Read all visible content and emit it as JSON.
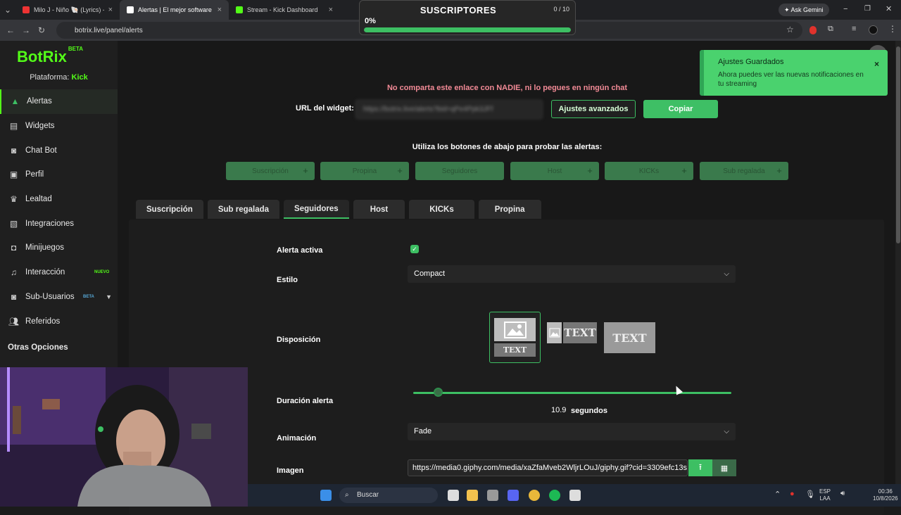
{
  "browser": {
    "tabs": [
      {
        "title": "Milo J - Niño 🐚 (Lyrics) - Y"
      },
      {
        "title": "Alertas | El mejor software para"
      },
      {
        "title": "Stream - Kick Dashboard"
      }
    ],
    "url": "botrix.live/panel/alerts",
    "ask_gemini": "Ask Gemini"
  },
  "subs_widget": {
    "title": "SUSCRIPTORES",
    "count": "0 / 10",
    "percent_label": "0%",
    "progress": 0.0
  },
  "sidebar": {
    "logo": "BotRix",
    "logo_badge": "BETA",
    "platform_label": "Plataforma:",
    "platform_value": "Kick",
    "items": [
      {
        "label": "Alertas",
        "icon": "warning-icon"
      },
      {
        "label": "Widgets",
        "icon": "widgets-icon"
      },
      {
        "label": "Chat Bot",
        "icon": "robot-icon"
      },
      {
        "label": "Perfil",
        "icon": "profile-card-icon"
      },
      {
        "label": "Lealtad",
        "icon": "trophy-icon"
      },
      {
        "label": "Integraciones",
        "icon": "integrations-icon"
      },
      {
        "label": "Minijuegos",
        "icon": "gamepad-icon"
      },
      {
        "label": "Interacción",
        "icon": "music-note-icon",
        "badge": "NUEVO"
      },
      {
        "label": "Sub-Usuarios",
        "icon": "robot-icon",
        "badge": "BETA"
      },
      {
        "label": "Referidos",
        "icon": "users-icon"
      }
    ],
    "other_options": "Otras Opciones"
  },
  "main": {
    "warning": "No comparta este enlace con NADIE, ni lo pegues en ningún chat",
    "url_label": "URL del widget:",
    "url_value": "https://botrix.live/alerts?bid=qPe4Ppk3JFf",
    "advanced_button": "Ajustes avanzados",
    "copy_button": "Copiar",
    "test_title": "Utiliza los botones de abajo para probar las alertas:",
    "test_buttons": [
      "Suscripción",
      "Propina",
      "Seguidores",
      "Host",
      "KICKs",
      "Sub regalada"
    ],
    "tabs": [
      "Suscripción",
      "Sub regalada",
      "Seguidores",
      "Host",
      "KICKs",
      "Propina"
    ],
    "active_tab": "Seguidores",
    "fields": {
      "alert_active_label": "Alerta activa",
      "style_label": "Estilo",
      "style_value": "Compact",
      "layout_label": "Disposición",
      "layout_text": "TEXT",
      "duration_label": "Duración alerta",
      "duration_value": "10.9",
      "duration_unit": "segundos",
      "duration_fraction": 0.08,
      "animation_label": "Animación",
      "animation_value": "Fade",
      "image_label": "Imagen",
      "image_value": "https://media0.giphy.com/media/xaZfaMveb2WljrLOuJ/giphy.gif?cid=3309efc13s"
    }
  },
  "toast": {
    "title": "Ajustes Guardados",
    "body": "Ahora puedes ver las nuevas notificaciones en tu streaming"
  },
  "taskbar": {
    "search": "Buscar",
    "lang": "ESP",
    "region": "LAA",
    "time": "00:36",
    "date": "10/8/2026"
  }
}
